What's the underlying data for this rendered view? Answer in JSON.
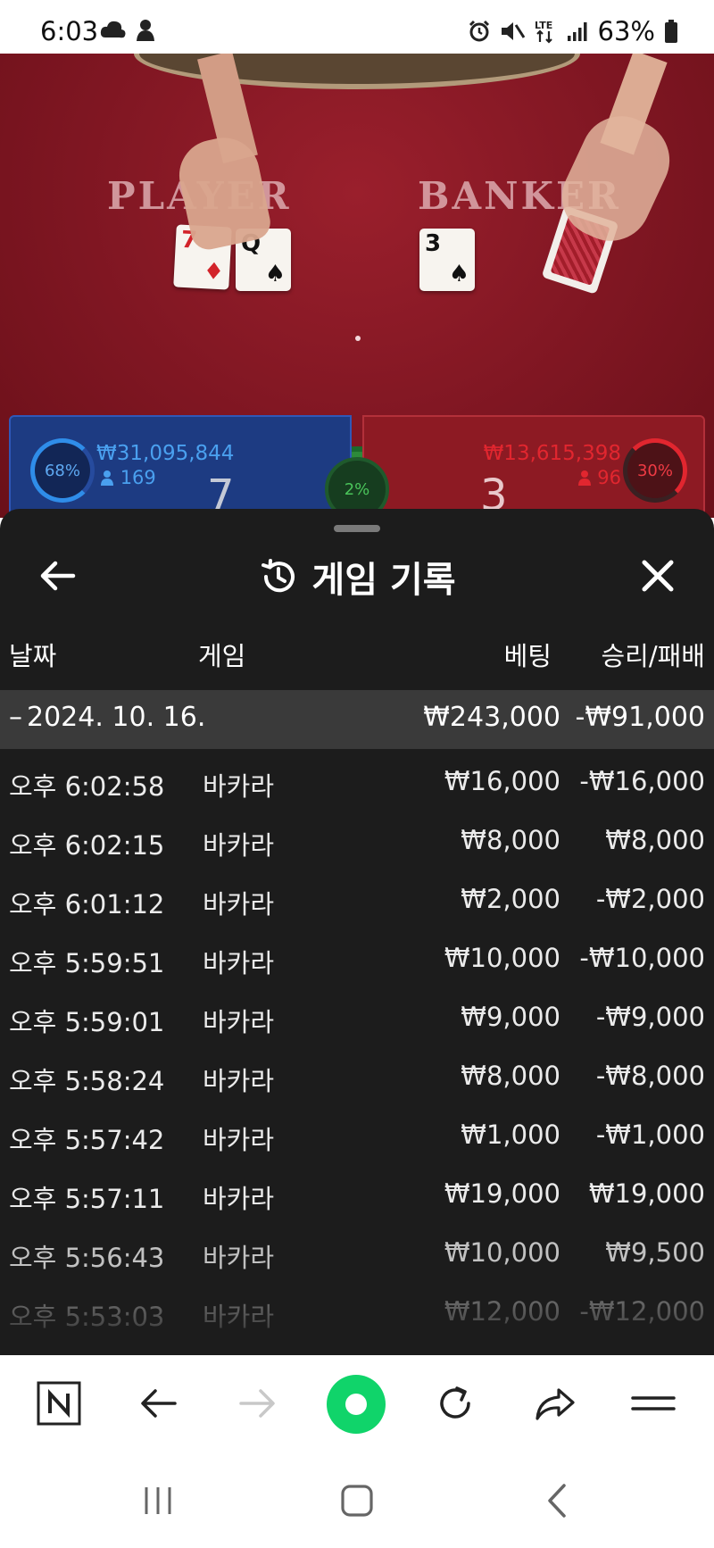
{
  "status_bar": {
    "time": "6:03",
    "battery_percent": "63%",
    "left_icons": [
      "cloud-icon",
      "app-icon"
    ],
    "right_icons": [
      "alarm-icon",
      "mute-icon",
      "lte-icon",
      "signal-icon",
      "battery-icon"
    ]
  },
  "game": {
    "player_label": "PLAYER",
    "banker_label": "BANKER",
    "player_cards": [
      {
        "rank": "7",
        "suit": "♦",
        "color": "#d2232a"
      },
      {
        "rank": "Q",
        "suit": "♠",
        "color": "#111111"
      }
    ],
    "banker_cards": [
      {
        "rank": "3",
        "suit": "♠",
        "color": "#111111"
      }
    ],
    "player_panel": {
      "percent": "68%",
      "amount": "₩31,095,844",
      "users": "169",
      "score": "7"
    },
    "banker_panel": {
      "percent": "30%",
      "amount": "₩13,615,398",
      "users": "96",
      "score": "3"
    },
    "tie_percent": "2%"
  },
  "sheet": {
    "title": "게임 기록",
    "columns": {
      "date": "날짜",
      "game": "게임",
      "bet": "베팅",
      "result": "승리/패배"
    },
    "date_group": {
      "toggle": "–",
      "date": "2024. 10. 16.",
      "bet": "₩243,000",
      "result": "-₩91,000"
    },
    "rows": [
      {
        "time": "오후 6:02:58",
        "game": "바카라",
        "bet": "₩16,000",
        "result": "-₩16,000"
      },
      {
        "time": "오후 6:02:15",
        "game": "바카라",
        "bet": "₩8,000",
        "result": "₩8,000"
      },
      {
        "time": "오후 6:01:12",
        "game": "바카라",
        "bet": "₩2,000",
        "result": "-₩2,000"
      },
      {
        "time": "오후 5:59:51",
        "game": "바카라",
        "bet": "₩10,000",
        "result": "-₩10,000"
      },
      {
        "time": "오후 5:59:01",
        "game": "바카라",
        "bet": "₩9,000",
        "result": "-₩9,000"
      },
      {
        "time": "오후 5:58:24",
        "game": "바카라",
        "bet": "₩8,000",
        "result": "-₩8,000"
      },
      {
        "time": "오후 5:57:42",
        "game": "바카라",
        "bet": "₩1,000",
        "result": "-₩1,000"
      },
      {
        "time": "오후 5:57:11",
        "game": "바카라",
        "bet": "₩19,000",
        "result": "₩19,000"
      },
      {
        "time": "오후 5:56:43",
        "game": "바카라",
        "bet": "₩10,000",
        "result": "₩9,500"
      },
      {
        "time": "오후 5:53:03",
        "game": "바카라",
        "bet": "₩12,000",
        "result": "-₩12,000"
      }
    ]
  },
  "colors": {
    "sheet_bg": "#1c1c1c",
    "date_row_bg": "#3a3a3a",
    "player_blue": "#4aa0ef",
    "banker_red": "#e1262f",
    "tie_green": "#4ac45a",
    "browser_accent": "#10d46a"
  }
}
